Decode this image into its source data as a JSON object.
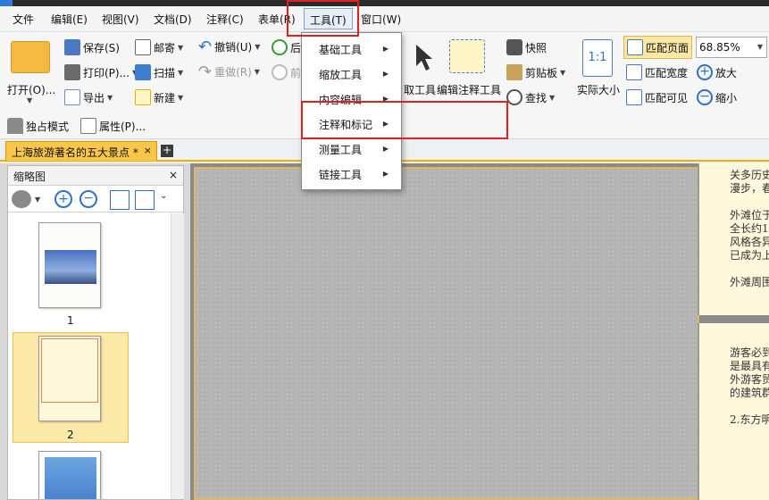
{
  "menubar": {
    "items": [
      "文件",
      "编辑(E)",
      "视图(V)",
      "文档(D)",
      "注释(C)",
      "表单(R)",
      "工具(T)",
      "窗口(W)"
    ],
    "active": "工具(T)"
  },
  "ribbon": {
    "open": "打开(O)...",
    "save": "保存(S)",
    "mail": "邮寄",
    "undo": "撤销(U)",
    "back_partial": "后",
    "print": "打印(P)...",
    "scan": "扫描",
    "redo": "重做(R)",
    "forward_partial": "前",
    "export": "导出",
    "new": "新建",
    "exclusive_mode": "独占模式",
    "properties": "属性(P)...",
    "select_tool_partial": "取工具",
    "edit_annotation_tool": "编辑注释工具",
    "snapshot": "快照",
    "clipboard": "剪贴板",
    "find": "查找",
    "actual_size": "实际大小",
    "actual_size_icon_text": "1:1",
    "fit_page": "匹配页面",
    "fit_width": "匹配宽度",
    "fit_visible": "匹配可见",
    "zoom_value": "68.85%",
    "zoom_in": "放大",
    "zoom_out": "缩小"
  },
  "tabs": {
    "active_label": "上海旅游著名的五大景点 *",
    "close": "×",
    "add": "+"
  },
  "thumbnails": {
    "title": "缩略图",
    "close": "×",
    "pages": [
      "1",
      "2"
    ],
    "selected_page": "2"
  },
  "dropdown": {
    "items": [
      "基础工具",
      "缩放工具",
      "内容编辑",
      "注释和标记",
      "测量工具",
      "链接工具"
    ],
    "highlighted": "注释和标记"
  },
  "document": {
    "page1_lines": [
      "关多历史",
      "漫步，春",
      "",
      "外滩位于",
      "全长约1",
      "风格各异",
      "已成为上",
      "",
      "外滩周围"
    ],
    "page2_lines": [
      "游客必到",
      "是最具有",
      "外游客贸",
      "的建筑群",
      "",
      "2.东方明"
    ]
  },
  "colors": {
    "tab_active": "#f7c64a",
    "highlight_box": "#e02020",
    "page_background": "#fff8dc"
  }
}
